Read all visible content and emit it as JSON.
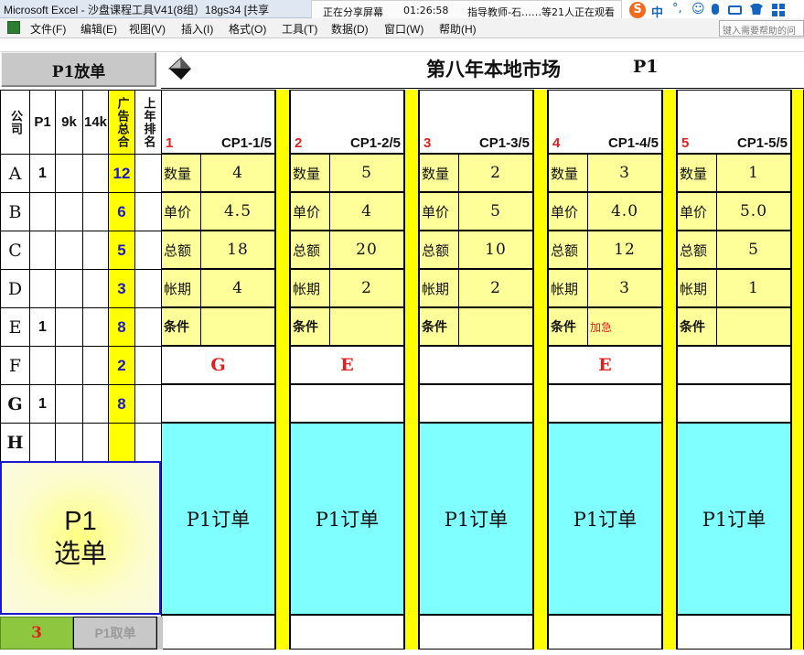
{
  "window": {
    "title": "Microsoft Excel - 沙盘课程工具V41(8组）18gs34  [共享"
  },
  "share_bar": {
    "status": "正在分享屏幕",
    "time": "01:26:58",
    "viewers": "指导教师-石……等21人正在观看"
  },
  "menu": [
    "文件(F)",
    "编辑(E)",
    "视图(V)",
    "插入(I)",
    "格式(O)",
    "工具(T)",
    "数据(D)",
    "窗口(W)",
    "帮助(H)"
  ],
  "help_placeholder": "键入需要帮助的问",
  "ime": {
    "lang": "中"
  },
  "left_panel": {
    "place_button": "P1放单",
    "headers": {
      "company": "公司",
      "p1": "P1",
      "k9": "9k",
      "k14": "14k",
      "ad_total": "广告总合",
      "last_rank": "上年排名"
    },
    "rows": [
      {
        "co": "A",
        "p1": "1",
        "ad": "12"
      },
      {
        "co": "B",
        "p1": "",
        "ad": "6"
      },
      {
        "co": "C",
        "p1": "",
        "ad": "5"
      },
      {
        "co": "D",
        "p1": "",
        "ad": "3"
      },
      {
        "co": "E",
        "p1": "1",
        "ad": "8"
      },
      {
        "co": "F",
        "p1": "",
        "ad": "2"
      },
      {
        "co": "G",
        "p1": "1",
        "ad": "8"
      },
      {
        "co": "H",
        "p1": "",
        "ad": ""
      }
    ],
    "select_line1": "P1",
    "select_line2": "选单",
    "bottom_num": "3",
    "cancel_button": "P1取单"
  },
  "market": {
    "title": "第八年本地市场",
    "product": "P1"
  },
  "labels": {
    "qty": "数量",
    "price": "单价",
    "total": "总额",
    "term": "帐期",
    "cond": "条件",
    "order_button": "P1订单"
  },
  "orders": [
    {
      "num": "1",
      "code": "CP1-1/5",
      "qty": "4",
      "price": "4.5",
      "total": "18",
      "term": "4",
      "cond": "",
      "winner": "G"
    },
    {
      "num": "2",
      "code": "CP1-2/5",
      "qty": "5",
      "price": "4",
      "total": "20",
      "term": "2",
      "cond": "",
      "winner": "E"
    },
    {
      "num": "3",
      "code": "CP1-3/5",
      "qty": "2",
      "price": "5",
      "total": "10",
      "term": "2",
      "cond": "",
      "winner": ""
    },
    {
      "num": "4",
      "code": "CP1-4/5",
      "qty": "3",
      "price": "4.0",
      "total": "12",
      "term": "3",
      "cond": "加急",
      "winner": "E"
    },
    {
      "num": "5",
      "code": "CP1-5/5",
      "qty": "1",
      "price": "5.0",
      "total": "5",
      "term": "1",
      "cond": "",
      "winner": ""
    }
  ]
}
